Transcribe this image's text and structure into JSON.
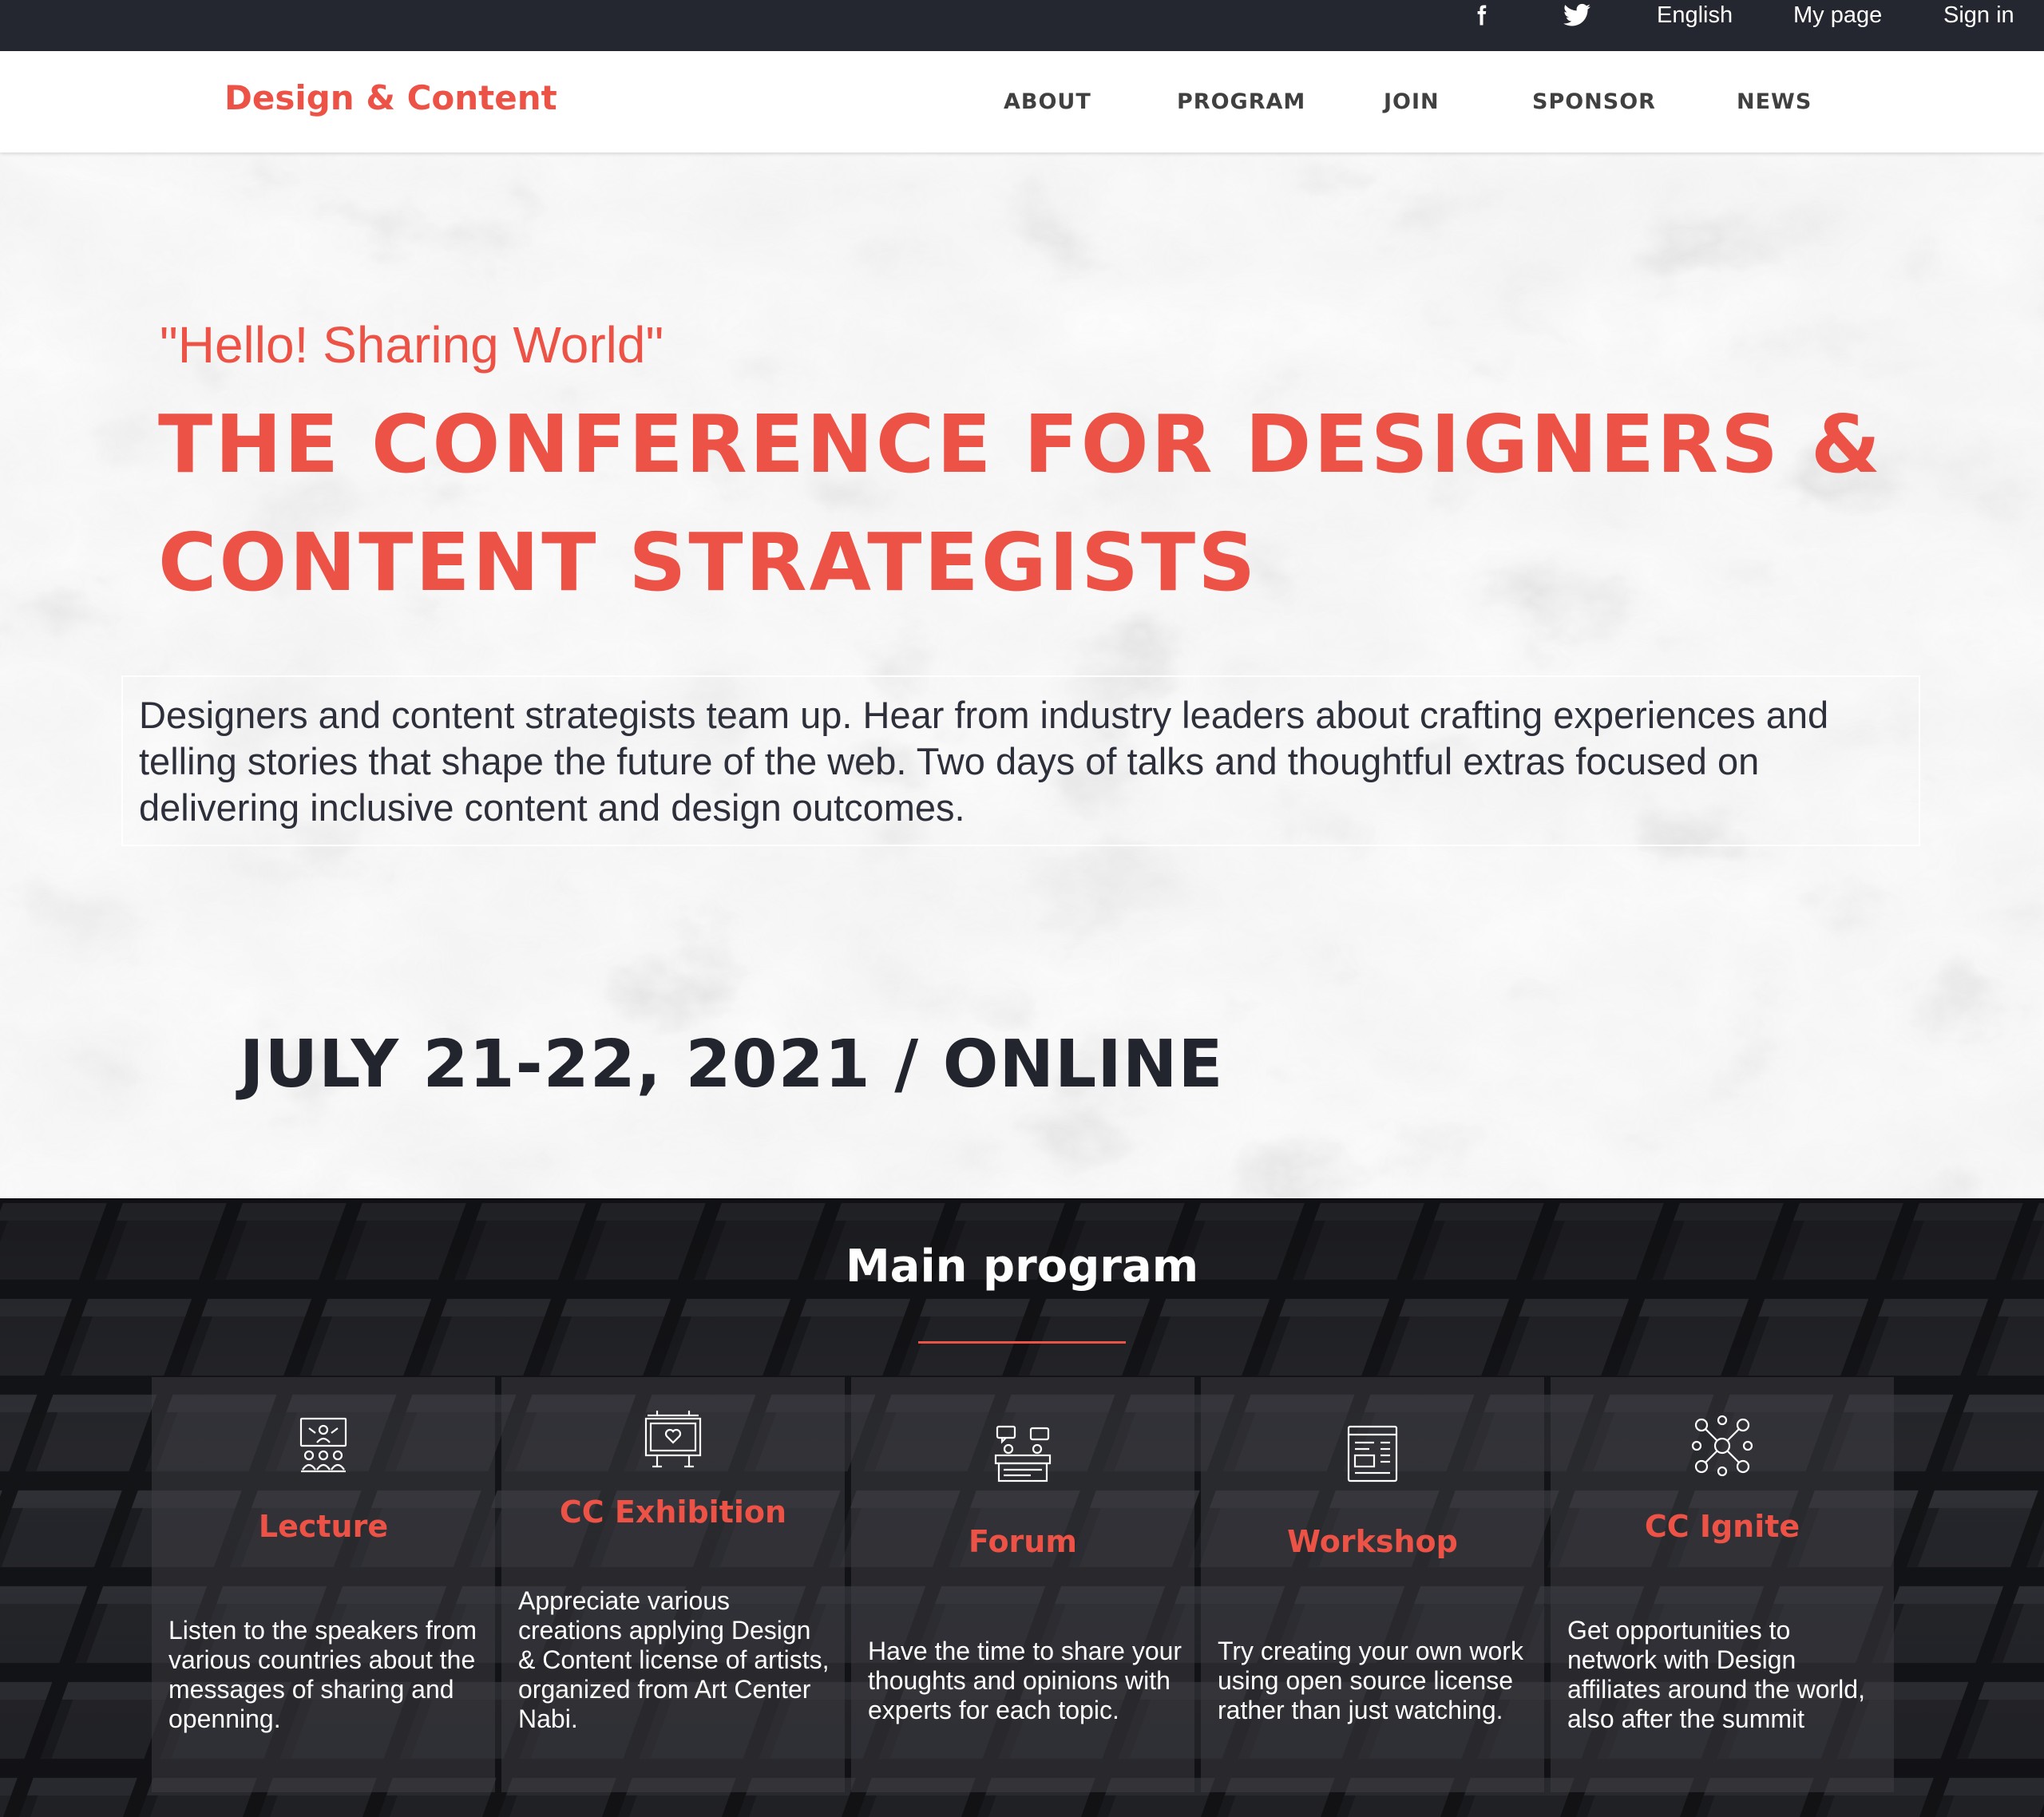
{
  "top_bar": {
    "facebook_icon": "facebook-icon",
    "twitter_icon": "twitter-icon",
    "language": "English",
    "my_page": "My page",
    "sign_in": "Sign in"
  },
  "header": {
    "logo": "Design & Content",
    "nav": [
      "ABOUT",
      "PROGRAM",
      "JOIN",
      "SPONSOR",
      "NEWS"
    ]
  },
  "hero": {
    "tagline": "\"Hello! Sharing World\"",
    "headline_line1": "THE CONFERENCE FOR DESIGNERS &",
    "headline_line2": "CONTENT STRATEGISTS",
    "description": "Designers and content strategists team up. Hear from industry leaders about crafting experiences and telling stories that shape the future of the web. Two days of talks and thoughtful extras focused on delivering inclusive content and design outcomes.",
    "date": "JULY 21-22, 2021 / ONLINE"
  },
  "program": {
    "title": "Main program",
    "cards": [
      {
        "title": "Lecture",
        "icon": "lecture-icon",
        "description": "Listen to the speakers from various countries about the messages of sharing and openning."
      },
      {
        "title": "CC Exhibition",
        "icon": "exhibition-icon",
        "description": "Appreciate various creations applying Design & Content license of artists, organized from Art Center Nabi."
      },
      {
        "title": "Forum",
        "icon": "forum-icon",
        "description": "Have the time to share your thoughts and opinions with experts for each topic."
      },
      {
        "title": "Workshop",
        "icon": "workshop-icon",
        "description": "Try creating your own work using open source license rather than just watching."
      },
      {
        "title": "CC Ignite",
        "icon": "network-icon",
        "description": "Get opportunities to network with Design affiliates around the world, also after the summit"
      }
    ]
  },
  "colors": {
    "accent": "#ec5246",
    "topbar": "#252730",
    "dark_text": "#23252e",
    "program_bg": "#1a1b1f"
  }
}
